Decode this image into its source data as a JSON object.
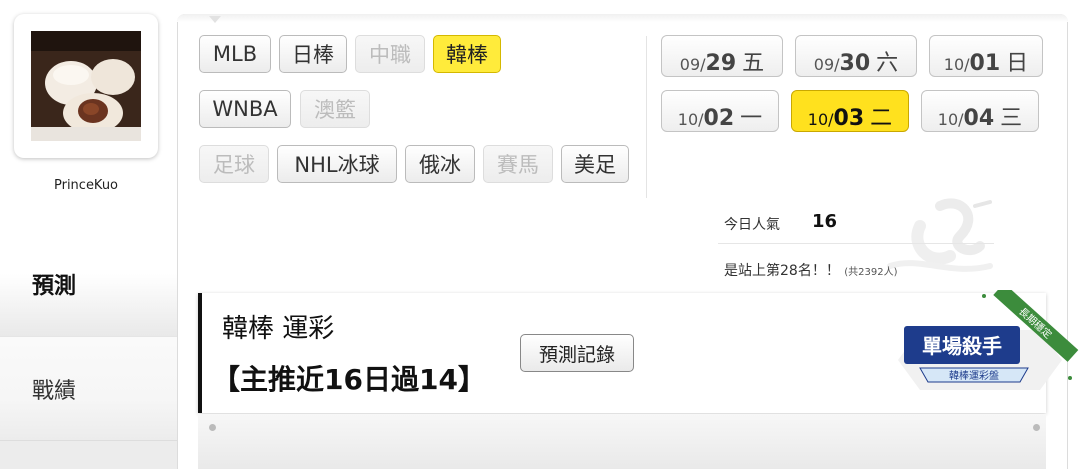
{
  "user": {
    "name": "PrinceKuo"
  },
  "sidebar": {
    "tabs": [
      {
        "label": "預測",
        "active": true
      },
      {
        "label": "戰績",
        "active": false
      }
    ]
  },
  "sports": [
    {
      "label": "MLB",
      "state": "enabled"
    },
    {
      "label": "日棒",
      "state": "enabled"
    },
    {
      "label": "中職",
      "state": "disabled"
    },
    {
      "label": "韓棒",
      "state": "active"
    },
    {
      "label": "WNBA",
      "state": "enabled"
    },
    {
      "label": "澳籃",
      "state": "disabled"
    },
    {
      "label": "足球",
      "state": "disabled"
    },
    {
      "label": "NHL冰球",
      "state": "enabled"
    },
    {
      "label": "俄冰",
      "state": "enabled"
    },
    {
      "label": "賽馬",
      "state": "disabled"
    },
    {
      "label": "美足",
      "state": "enabled"
    }
  ],
  "dates": [
    {
      "md": "09/",
      "dd": "29",
      "wd": "五",
      "active": false
    },
    {
      "md": "09/",
      "dd": "30",
      "wd": "六",
      "active": false
    },
    {
      "md": "10/",
      "dd": "01",
      "wd": "日",
      "active": false
    },
    {
      "md": "10/",
      "dd": "02",
      "wd": "一",
      "active": false
    },
    {
      "md": "10/",
      "dd": "03",
      "wd": "二",
      "active": true
    },
    {
      "md": "10/",
      "dd": "04",
      "wd": "三",
      "active": false
    }
  ],
  "stats": {
    "popularity_label": "今日人氣",
    "popularity_value": "16",
    "rank_text": "是站上第28名！！",
    "rank_total": "(共2392人)"
  },
  "card": {
    "title": "韓棒 運彩",
    "subtitle": "【主推近16日過14】",
    "record_button": "預測記錄"
  },
  "badge": {
    "main": "單場殺手",
    "sub": "韓棒運彩盤",
    "ribbon": "長期穩定"
  },
  "colors": {
    "active": "#ffe11e",
    "accent_dark": "#1e3c8c"
  }
}
